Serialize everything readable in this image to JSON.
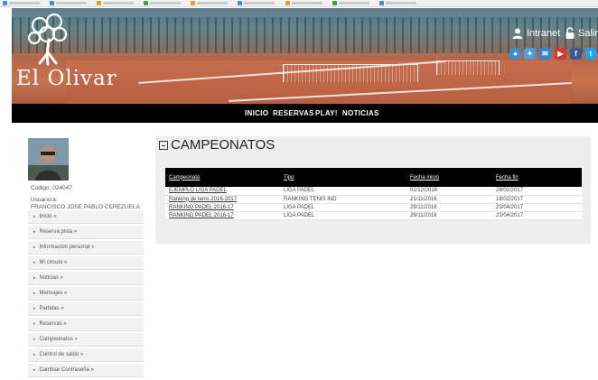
{
  "header": {
    "logo_text": "El Olivar",
    "intranet_label": "Intranet",
    "logout_label": "Salir",
    "social_icons": [
      "app-icon",
      "maps-icon",
      "mail-icon",
      "youtube-icon",
      "facebook-icon",
      "twitter-icon"
    ]
  },
  "nav": {
    "items": [
      "INICIO",
      "RESERVAS",
      "PLAY!",
      "NOTICIAS"
    ]
  },
  "sidebar": {
    "code": "Código: 024047",
    "user_label": "Usuario/a:",
    "user_name": "FRANCISCO JOSE PABLO CEREZUELA",
    "menu": [
      "Inicio »",
      "Reserva pista »",
      "Información personal »",
      "Mi círculo »",
      "Noticias »",
      "Mensajes »",
      "Partidas »",
      "Reservas »",
      "Campeonatos »",
      "Control de saldo »",
      "Cambiar Contraseña »"
    ]
  },
  "main": {
    "title": "CAMPEONATOS",
    "columns": [
      "Campeonato",
      "Tipo",
      "Fecha inicio",
      "Fecha fin"
    ],
    "rows": [
      [
        "EJEMPLO LIGA PADEL",
        "LIGA PADEL",
        "01/12/2016",
        "28/02/2017"
      ],
      [
        "Ranking de tenis 2016-2017",
        "RANKING TENIS IND",
        "21/11/2016",
        "18/02/2017"
      ],
      [
        "RANKING PADEL 2016-17",
        "LIGA PADEL",
        "29/11/2016",
        "23/04/2017"
      ],
      [
        "RANKING PADEL 2016-17",
        "LIGA PADEL",
        "29/11/2016",
        "23/04/2017"
      ]
    ]
  },
  "colors": {
    "navbar": "#000000",
    "table_header": "#000000",
    "panel_bg": "#eeeeee"
  }
}
